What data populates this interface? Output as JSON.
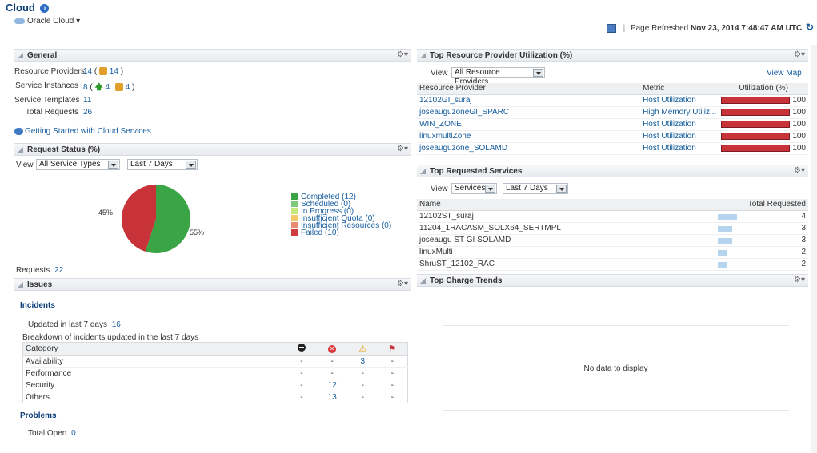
{
  "header": {
    "title": "Cloud",
    "breadcrumb": "Oracle Cloud",
    "refresh_prefix": "Page Refreshed",
    "refresh_time": "Nov 23, 2014 7:48:47 AM UTC"
  },
  "general": {
    "title": "General",
    "resource_providers_label": "Resource Providers",
    "resource_providers_value": "14",
    "resource_providers_icon_count": "14",
    "service_instances_label": "Service Instances",
    "service_instances_value": "8",
    "service_instances_up": "4",
    "service_instances_other": "4",
    "service_templates_label": "Service Templates",
    "service_templates_value": "11",
    "total_requests_label": "Total Requests",
    "total_requests_value": "26",
    "getting_started": "Getting Started with Cloud Services"
  },
  "request_status": {
    "title": "Request Status (%)",
    "view_label": "View",
    "service_type_select": "All Service Types",
    "period_select": "Last 7 Days",
    "requests_label": "Requests",
    "requests_value": "22",
    "pct_failed_label": "45%",
    "pct_completed_label": "55%",
    "legend": [
      {
        "label": "Completed (12)",
        "color": "#3aa545"
      },
      {
        "label": "Scheduled (0)",
        "color": "#7fc97a"
      },
      {
        "label": "In Progress (0)",
        "color": "#c5e77c"
      },
      {
        "label": "Insufficient Quota (0)",
        "color": "#f4c86b"
      },
      {
        "label": "Insufficient Resources (0)",
        "color": "#e78a6f"
      },
      {
        "label": "Failed (10)",
        "color": "#cf3c3e"
      }
    ],
    "chart_data": {
      "type": "pie",
      "categories": [
        "Completed",
        "Failed"
      ],
      "values": [
        55,
        45
      ]
    }
  },
  "issues": {
    "title": "Issues",
    "incidents_heading": "Incidents",
    "updated_label": "Updated in last 7 days",
    "updated_value": "16",
    "breakdown_label": "Breakdown of incidents updated in the last 7 days",
    "category_header": "Category",
    "rows": [
      {
        "category": "Availability",
        "c1": "-",
        "c2": "-",
        "c3": "3",
        "c4": "-"
      },
      {
        "category": "Performance",
        "c1": "-",
        "c2": "-",
        "c3": "-",
        "c4": "-"
      },
      {
        "category": "Security",
        "c1": "-",
        "c2": "12",
        "c3": "-",
        "c4": "-"
      },
      {
        "category": "Others",
        "c1": "-",
        "c2": "13",
        "c3": "-",
        "c4": "-"
      }
    ],
    "problems_heading": "Problems",
    "total_open_label": "Total Open",
    "total_open_value": "0"
  },
  "utilization": {
    "title": "Top Resource Provider Utilization (%)",
    "view_label": "View",
    "provider_select": "All Resource Providers",
    "view_map": "View Map",
    "headers": [
      "Resource Provider",
      "Metric",
      "Utilization (%)"
    ],
    "rows": [
      {
        "provider": "12102GI_suraj",
        "metric": "Host Utilization",
        "value": "100"
      },
      {
        "provider": "joseauguzoneGI_SPARC",
        "metric": "High Memory Utiliz...",
        "value": "100"
      },
      {
        "provider": "WIN_ZONE",
        "metric": "Host Utilization",
        "value": "100"
      },
      {
        "provider": "linuxmultiZone",
        "metric": "Host Utilization",
        "value": "100"
      },
      {
        "provider": "joseauguzone_SOLAMD",
        "metric": "Host Utilization",
        "value": "100"
      }
    ]
  },
  "requested": {
    "title": "Top Requested Services",
    "view_label": "View",
    "type_select": "Services",
    "period_select": "Last 7 Days",
    "headers": [
      "Name",
      "Total Requested"
    ],
    "rows": [
      {
        "name": "12102ST_suraj",
        "value": "4"
      },
      {
        "name": "11204_1RACASM_SOLX64_SERTMPL",
        "value": "3"
      },
      {
        "name": "joseaugu ST GI SOLAMD",
        "value": "3"
      },
      {
        "name": "linuxMulti",
        "value": "2"
      },
      {
        "name": "ShruST_12102_RAC",
        "value": "2"
      }
    ]
  },
  "charge": {
    "title": "Top Charge Trends",
    "empty_text": "No data to display"
  },
  "colors": {
    "accent": "#0b3e7a",
    "link": "#145c9e",
    "bar_red": "#c8333a",
    "bar_blue": "#b7d4ee"
  }
}
